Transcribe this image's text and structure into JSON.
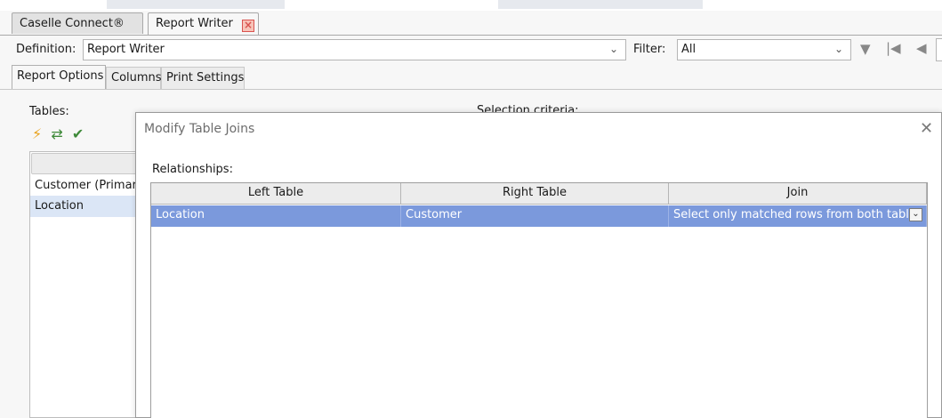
{
  "tabs": [
    {
      "label": "Caselle Connect®"
    },
    {
      "label": "Report Writer"
    }
  ],
  "definition": {
    "label": "Definition:",
    "value": "Report Writer"
  },
  "filter": {
    "label": "Filter:",
    "value": "All"
  },
  "option_tabs": [
    {
      "label": "Report Options"
    },
    {
      "label": "Columns"
    },
    {
      "label": "Print Settings"
    }
  ],
  "tables_label": "Tables:",
  "selection_criteria_label": "Selection criteria:",
  "tables_list": [
    {
      "label": "Customer (Primary)"
    },
    {
      "label": "Location"
    }
  ],
  "modal": {
    "title": "Modify Table Joins",
    "relationships_label": "Relationships:",
    "columns": [
      "Left Table",
      "Right Table",
      "Join"
    ],
    "rows": [
      {
        "left": "Location",
        "right": "Customer",
        "join": "Select only matched rows from both tables"
      }
    ]
  },
  "colors": {
    "selected_row": "#7b99dc",
    "selected_list_item": "#dbe6f6",
    "close_tab": "#d9534f"
  },
  "icons": [
    "lightning-icon",
    "table-arrows-icon",
    "table-check-icon",
    "filter-icon",
    "first-page-icon",
    "prev-page-icon",
    "close-icon",
    "chevron-down-icon"
  ]
}
